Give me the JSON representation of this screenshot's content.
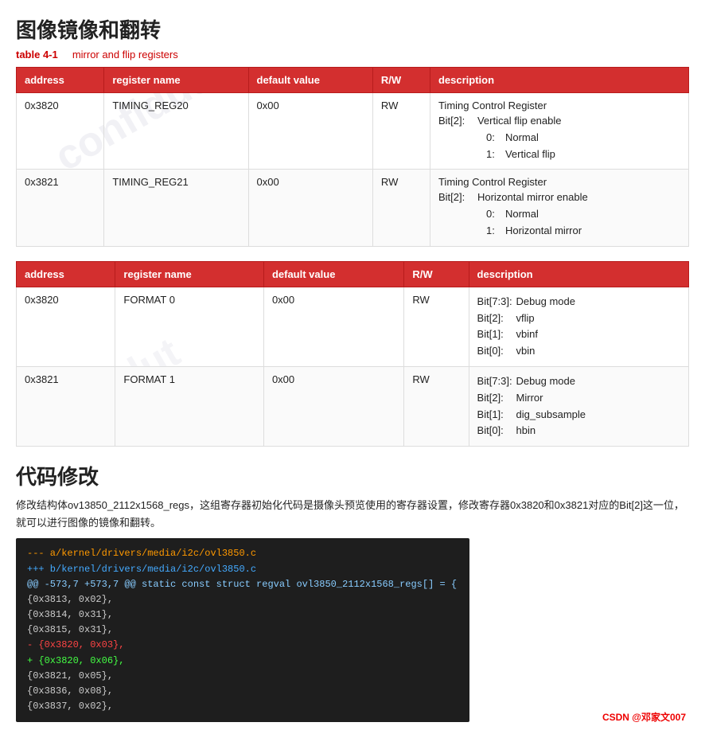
{
  "page": {
    "title": "图像镜像和翻转",
    "watermark": "confidut",
    "csdn_badge": "CSDN @邓家文007"
  },
  "table1": {
    "label_key": "table 4-1",
    "label_value": "mirror and flip registers",
    "headers": [
      "address",
      "register name",
      "default value",
      "R/W",
      "description"
    ],
    "rows": [
      {
        "address": "0x3820",
        "register": "TIMING_REG20",
        "default": "0x00",
        "rw": "RW",
        "desc_title": "Timing Control Register",
        "desc_bits": [
          {
            "bit": "Bit[2]:",
            "text": "Vertical flip enable"
          },
          {
            "bit": "0:",
            "text": "Normal",
            "indent": true
          },
          {
            "bit": "1:",
            "text": "Vertical flip",
            "indent": true
          }
        ]
      },
      {
        "address": "0x3821",
        "register": "TIMING_REG21",
        "default": "0x00",
        "rw": "RW",
        "desc_title": "Timing Control Register",
        "desc_bits": [
          {
            "bit": "Bit[2]:",
            "text": "Horizontal mirror enable"
          },
          {
            "bit": "0:",
            "text": "Normal",
            "indent": true
          },
          {
            "bit": "1:",
            "text": "Horizontal mirror",
            "indent": true
          }
        ]
      }
    ]
  },
  "table2": {
    "headers": [
      "address",
      "register name",
      "default value",
      "R/W",
      "description"
    ],
    "rows": [
      {
        "address": "0x3820",
        "register": "FORMAT 0",
        "default": "0x00",
        "rw": "RW",
        "desc_bits": [
          {
            "bit": "Bit[7:3]:",
            "text": "Debug mode"
          },
          {
            "bit": "Bit[2]:",
            "text": "vflip"
          },
          {
            "bit": "Bit[1]:",
            "text": "vbinf"
          },
          {
            "bit": "Bit[0]:",
            "text": "vbin"
          }
        ]
      },
      {
        "address": "0x3821",
        "register": "FORMAT 1",
        "default": "0x00",
        "rw": "RW",
        "desc_bits": [
          {
            "bit": "Bit[7:3]:",
            "text": "Debug mode"
          },
          {
            "bit": "Bit[2]:",
            "text": "Mirror"
          },
          {
            "bit": "Bit[1]:",
            "text": "dig_subsample"
          },
          {
            "bit": "Bit[0]:",
            "text": "hbin"
          }
        ]
      }
    ]
  },
  "section2": {
    "title": "代码修改",
    "text": "修改结构体ov13850_2112x1568_regs，这组寄存器初始化代码是摄像头预览使用的寄存器设置，修改寄存器0x3820和0x3821对应的Bit[2]这一位，就可以进行图像的镜像和翻转。"
  },
  "code": {
    "lines": [
      {
        "type": "header-a",
        "text": "--- a/kernel/drivers/media/i2c/ovl3850.c"
      },
      {
        "type": "header-b",
        "text": "+++ b/kernel/drivers/media/i2c/ovl3850.c"
      },
      {
        "type": "hunk",
        "text": "@@ -573,7 +573,7 @@ static const struct regval ovl3850_2112x1568_regs[] = {"
      },
      {
        "type": "normal",
        "text": "        {0x3813, 0x02},"
      },
      {
        "type": "normal",
        "text": "        {0x3814, 0x31},"
      },
      {
        "type": "normal",
        "text": "        {0x3815, 0x31},"
      },
      {
        "type": "minus",
        "text": "-       {0x3820, 0x03},"
      },
      {
        "type": "plus",
        "text": "+       {0x3820, 0x06},"
      },
      {
        "type": "normal",
        "text": "        {0x3821, 0x05},"
      },
      {
        "type": "normal",
        "text": "        {0x3836, 0x08},"
      },
      {
        "type": "normal",
        "text": "        {0x3837, 0x02},"
      }
    ]
  }
}
